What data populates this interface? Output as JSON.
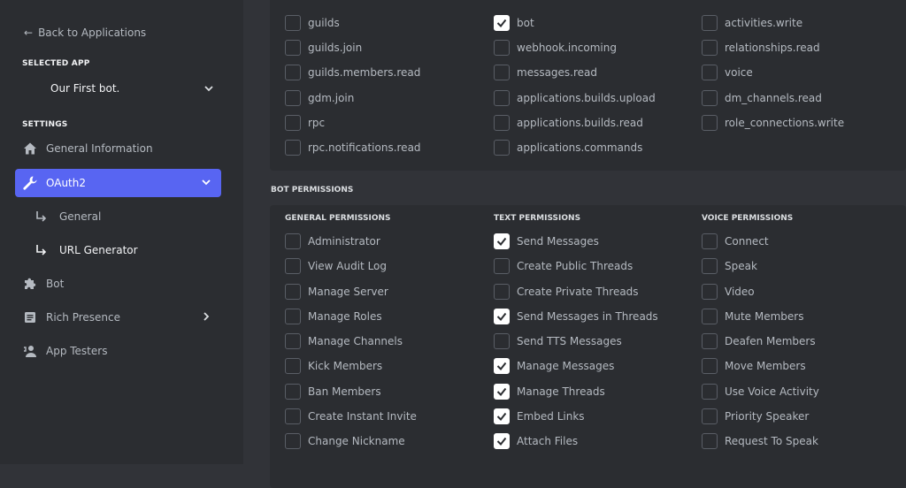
{
  "sidebar": {
    "back_label": "Back to Applications",
    "selected_app_label": "SELECTED APP",
    "app_name": "Our First bot.",
    "settings_label": "SETTINGS",
    "items": [
      {
        "label": "General Information",
        "icon": "home-icon"
      },
      {
        "label": "OAuth2",
        "icon": "wrench-icon",
        "active": true
      },
      {
        "label": "Bot",
        "icon": "puzzle-icon"
      },
      {
        "label": "Rich Presence",
        "icon": "document-icon"
      },
      {
        "label": "App Testers",
        "icon": "person-icon"
      }
    ],
    "oauth_sub": [
      {
        "label": "General"
      },
      {
        "label": "URL Generator",
        "selected": true
      }
    ]
  },
  "scopes": {
    "col1": [
      {
        "label": "guilds",
        "checked": false
      },
      {
        "label": "guilds.join",
        "checked": false
      },
      {
        "label": "guilds.members.read",
        "checked": false
      },
      {
        "label": "gdm.join",
        "checked": false
      },
      {
        "label": "rpc",
        "checked": false
      },
      {
        "label": "rpc.notifications.read",
        "checked": false
      }
    ],
    "col2": [
      {
        "label": "bot",
        "checked": true
      },
      {
        "label": "webhook.incoming",
        "checked": false
      },
      {
        "label": "messages.read",
        "checked": false
      },
      {
        "label": "applications.builds.upload",
        "checked": false
      },
      {
        "label": "applications.builds.read",
        "checked": false
      },
      {
        "label": "applications.commands",
        "checked": false
      }
    ],
    "col3": [
      {
        "label": "activities.write",
        "checked": false
      },
      {
        "label": "relationships.read",
        "checked": false
      },
      {
        "label": "voice",
        "checked": false
      },
      {
        "label": "dm_channels.read",
        "checked": false
      },
      {
        "label": "role_connections.write",
        "checked": false
      }
    ]
  },
  "bot_permissions": {
    "title": "BOT PERMISSIONS",
    "general": {
      "header": "GENERAL PERMISSIONS",
      "items": [
        {
          "label": "Administrator",
          "checked": false
        },
        {
          "label": "View Audit Log",
          "checked": false
        },
        {
          "label": "Manage Server",
          "checked": false
        },
        {
          "label": "Manage Roles",
          "checked": false
        },
        {
          "label": "Manage Channels",
          "checked": false
        },
        {
          "label": "Kick Members",
          "checked": false
        },
        {
          "label": "Ban Members",
          "checked": false
        },
        {
          "label": "Create Instant Invite",
          "checked": false
        },
        {
          "label": "Change Nickname",
          "checked": false
        }
      ]
    },
    "text": {
      "header": "TEXT PERMISSIONS",
      "items": [
        {
          "label": "Send Messages",
          "checked": true
        },
        {
          "label": "Create Public Threads",
          "checked": false
        },
        {
          "label": "Create Private Threads",
          "checked": false
        },
        {
          "label": "Send Messages in Threads",
          "checked": true
        },
        {
          "label": "Send TTS Messages",
          "checked": false
        },
        {
          "label": "Manage Messages",
          "checked": true
        },
        {
          "label": "Manage Threads",
          "checked": true
        },
        {
          "label": "Embed Links",
          "checked": true
        },
        {
          "label": "Attach Files",
          "checked": true
        }
      ]
    },
    "voice": {
      "header": "VOICE PERMISSIONS",
      "items": [
        {
          "label": "Connect",
          "checked": false
        },
        {
          "label": "Speak",
          "checked": false
        },
        {
          "label": "Video",
          "checked": false
        },
        {
          "label": "Mute Members",
          "checked": false
        },
        {
          "label": "Deafen Members",
          "checked": false
        },
        {
          "label": "Move Members",
          "checked": false
        },
        {
          "label": "Use Voice Activity",
          "checked": false
        },
        {
          "label": "Priority Speaker",
          "checked": false
        },
        {
          "label": "Request To Speak",
          "checked": false
        }
      ]
    }
  },
  "colors": {
    "accent": "#5865f2",
    "sidebar_bg": "#2b2d31",
    "main_bg": "#313338"
  }
}
